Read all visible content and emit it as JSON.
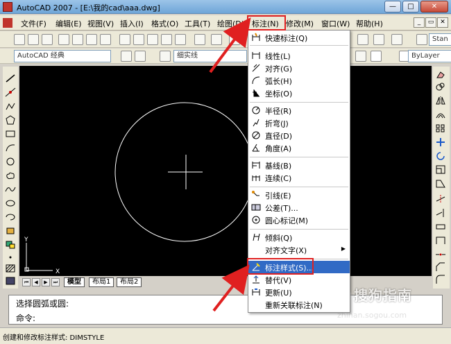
{
  "window": {
    "title": "AutoCAD 2007 - [E:\\我的cad\\aaa.dwg]",
    "min": "—",
    "max": "□",
    "close": "✕"
  },
  "menubar": {
    "items": [
      "文件(F)",
      "编辑(E)",
      "视图(V)",
      "插入(I)",
      "格式(O)",
      "工具(T)",
      "绘图(D)",
      "标注(N)",
      "修改(M)",
      "窗口(W)",
      "帮助(H)"
    ],
    "mdi": [
      "_",
      "▭",
      "✕"
    ]
  },
  "toolbar": {
    "workspace": "AutoCAD 经典",
    "style_combo": "Stan",
    "layer_combo": "细实线",
    "bylayer": "ByLayer"
  },
  "dimension_menu": {
    "items": [
      {
        "label": "快速标注(Q)",
        "icon": "quick-dimension-icon"
      },
      {
        "label": "线性(L)",
        "icon": "linear-icon"
      },
      {
        "label": "对齐(G)",
        "icon": "aligned-icon"
      },
      {
        "label": "弧长(H)",
        "icon": "arc-length-icon"
      },
      {
        "label": "坐标(O)",
        "icon": "ordinate-icon"
      },
      {
        "label": "半径(R)",
        "icon": "radius-icon"
      },
      {
        "label": "折弯(J)",
        "icon": "jogged-icon"
      },
      {
        "label": "直径(D)",
        "icon": "diameter-icon"
      },
      {
        "label": "角度(A)",
        "icon": "angular-icon"
      },
      {
        "label": "基线(B)",
        "icon": "baseline-icon"
      },
      {
        "label": "连续(C)",
        "icon": "continue-icon"
      },
      {
        "label": "引线(E)",
        "icon": "leader-icon"
      },
      {
        "label": "公差(T)...",
        "icon": "tolerance-icon"
      },
      {
        "label": "圆心标记(M)",
        "icon": "center-mark-icon"
      },
      {
        "label": "倾斜(Q)",
        "icon": "oblique-icon"
      },
      {
        "label": "对齐文字(X)",
        "icon": ""
      },
      {
        "label": "标注样式(S)...",
        "icon": "dimension-style-icon"
      },
      {
        "label": "替代(V)",
        "icon": "override-icon"
      },
      {
        "label": "更新(U)",
        "icon": "update-icon"
      },
      {
        "label": "重新关联标注(N)",
        "icon": ""
      }
    ],
    "highlighted": "标注样式(S)..."
  },
  "layout_tabs": [
    "模型",
    "布局1",
    "布局2"
  ],
  "command": {
    "line1": "选择圆弧或圆:",
    "line2": "命令:"
  },
  "status": {
    "text": "创建和修改标注样式:  DIMSTYLE"
  },
  "ucs": {
    "x": "X",
    "y": "Y"
  },
  "watermark": {
    "brand": "搜狗指南",
    "url": "zhinan.sogou.com"
  },
  "colors": {
    "highlight": "#316ac5",
    "annotation": "#e02020",
    "canvas": "#000000"
  }
}
